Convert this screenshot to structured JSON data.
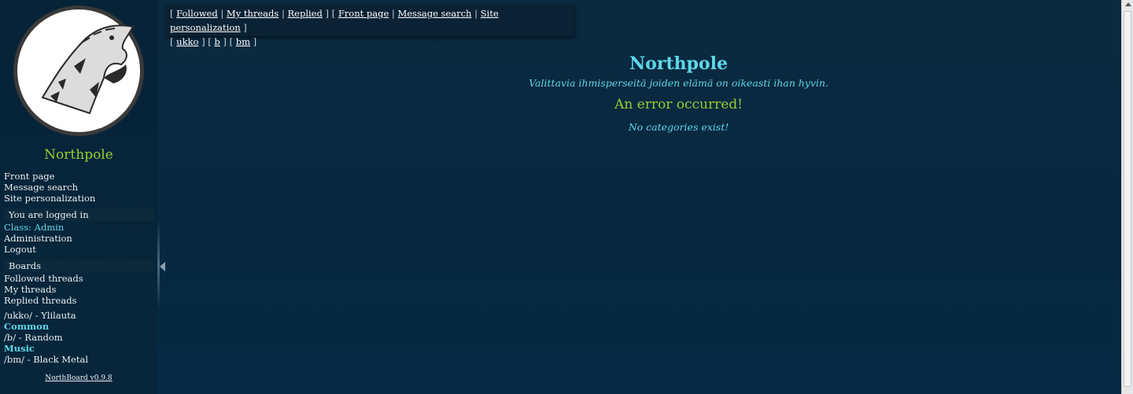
{
  "sidebar": {
    "logo_icon": "polar-bear-logo",
    "site_name": "Northpole",
    "links": [
      "Front page",
      "Message search",
      "Site personalization"
    ],
    "logged_in_header": "You are logged in",
    "class_label": "Class: Admin",
    "admin_links": [
      "Administration",
      "Logout"
    ],
    "boards_header": "Boards",
    "thread_links": [
      "Followed threads",
      "My threads",
      "Replied threads"
    ],
    "boards": {
      "ukko": "/ukko/ - Ylilauta",
      "category_common": "Common",
      "b": "/b/ - Random",
      "category_music": "Music",
      "bm": "/bm/ - Black Metal"
    },
    "version": "NorthBoard v0.9.8"
  },
  "topnav": {
    "followed": "Followed",
    "my_threads": "My threads",
    "replied": "Replied",
    "front_page": "Front page",
    "message_search": "Message search",
    "site_personalization": "Site personalization",
    "ukko": "ukko",
    "b": "b",
    "bm": "bm"
  },
  "main": {
    "title": "Northpole",
    "subtitle": "Valittavia ihmisperseitä joiden elämä on oikeasti ihan hyvin.",
    "error_title": "An error occurred!",
    "error_message": "No categories exist!"
  },
  "colors": {
    "accent": "#5fd7e8",
    "green": "#9acd32",
    "background": "#072840"
  }
}
